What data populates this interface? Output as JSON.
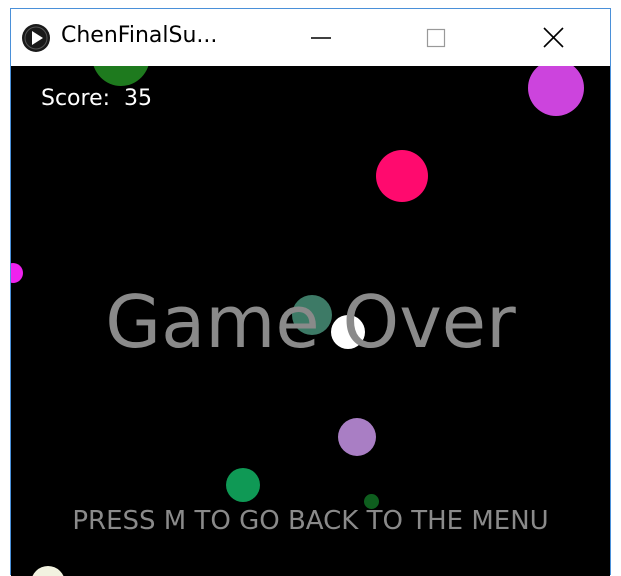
{
  "window": {
    "title": "ChenFinalSu...",
    "controls": {
      "minimize": "minimize-icon",
      "maximize": "maximize-icon",
      "close": "close-icon"
    }
  },
  "game": {
    "score_label": "Score:",
    "score_value": "35",
    "game_over_text": "Game Over",
    "menu_hint": "PRESS M TO GO BACK TO THE MENU",
    "background_color": "#000000",
    "balls": [
      {
        "color": "#1e7a1e",
        "name": "ball-dark-green-top"
      },
      {
        "color": "#cc44dd",
        "name": "ball-purple-top-right"
      },
      {
        "color": "#ff0a6e",
        "name": "ball-pink"
      },
      {
        "color": "#ee22ee",
        "name": "ball-magenta-left-edge"
      },
      {
        "color": "#3d7a66",
        "name": "ball-teal"
      },
      {
        "color": "#ffffff",
        "name": "ball-white-player"
      },
      {
        "color": "#a97ec4",
        "name": "ball-lavender"
      },
      {
        "color": "#0f9955",
        "name": "ball-green"
      },
      {
        "color": "#0e5e1e",
        "name": "ball-small-dark-green"
      },
      {
        "color": "#f2f2e0",
        "name": "ball-cream-bottom-left"
      }
    ]
  }
}
